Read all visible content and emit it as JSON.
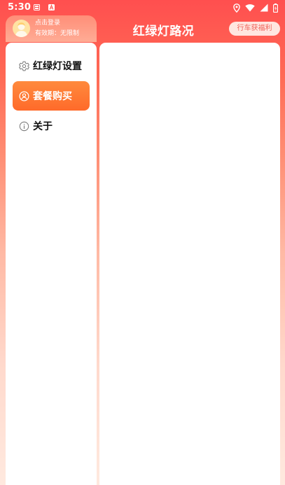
{
  "status_bar": {
    "time": "5:30"
  },
  "header": {
    "user": {
      "login_text": "点击登录",
      "validity_text": "有效期：无限制"
    },
    "title": "红绿灯路况",
    "reward_button_label": "行车获福利"
  },
  "sidebar": {
    "items": [
      {
        "label": "红绿灯设置",
        "icon": "gear-icon",
        "active": false
      },
      {
        "label": "套餐购买",
        "icon": "user-circle-icon",
        "active": true
      },
      {
        "label": "关于",
        "icon": "info-icon",
        "active": false
      }
    ]
  },
  "colors": {
    "accent_red": "#ff4f4f",
    "active_tab": "#ff7a33",
    "panel_bg": "#ffffff"
  }
}
